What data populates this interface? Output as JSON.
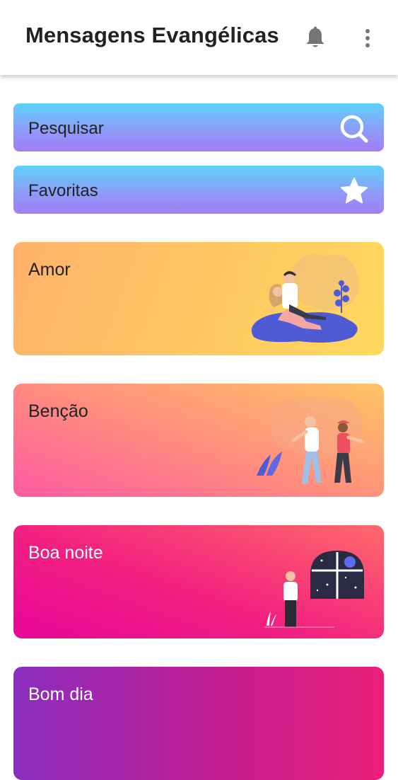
{
  "app": {
    "title": "Mensagens Evangélicas"
  },
  "icons": {
    "notifications": "bell-icon",
    "menu": "more-vertical-icon",
    "search": "search-icon",
    "favorites": "star-icon"
  },
  "actions": [
    {
      "label": "Pesquisar",
      "icon": "search-icon"
    },
    {
      "label": "Favoritas",
      "icon": "star-icon"
    }
  ],
  "categories": [
    {
      "label": "Amor",
      "text_color": "#222222"
    },
    {
      "label": "Benção",
      "text_color": "#222222"
    },
    {
      "label": "Boa noite",
      "text_color": "#ffffff"
    },
    {
      "label": "Bom dia",
      "text_color": "#ffffff"
    }
  ],
  "colors": {
    "accent_bar_top": "#5fd2fb",
    "accent_bar_bottom": "#a57cf6",
    "icon_gray": "#757575"
  }
}
